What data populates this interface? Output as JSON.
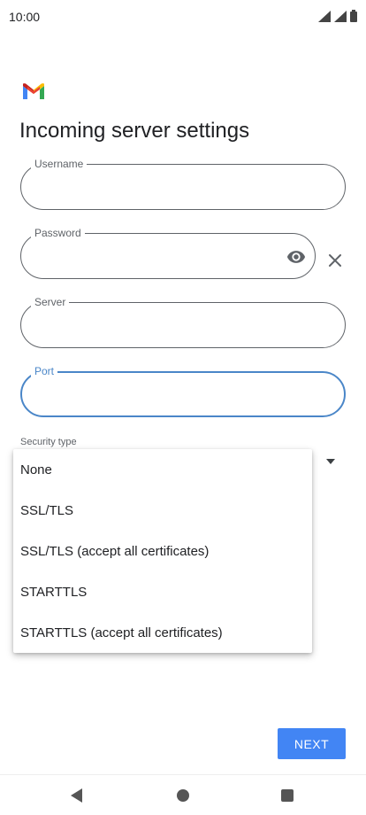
{
  "status_bar": {
    "time": "10:00",
    "icons": [
      "signal-icon",
      "signal-icon",
      "battery-icon"
    ]
  },
  "page": {
    "title": "Incoming server settings"
  },
  "fields": {
    "username": {
      "label": "Username",
      "value": ""
    },
    "password": {
      "label": "Password",
      "value": ""
    },
    "server": {
      "label": "Server",
      "value": ""
    },
    "port": {
      "label": "Port",
      "value": ""
    }
  },
  "security": {
    "label": "Security type",
    "options": [
      "None",
      "SSL/TLS",
      "SSL/TLS (accept all certificates)",
      "STARTTLS",
      "STARTTLS (accept all certificates)"
    ]
  },
  "actions": {
    "next_label": "NEXT"
  },
  "colors": {
    "accent": "#4285f4",
    "focus": "#4a86c8",
    "text": "#202124",
    "secondary_text": "#5f6368"
  }
}
